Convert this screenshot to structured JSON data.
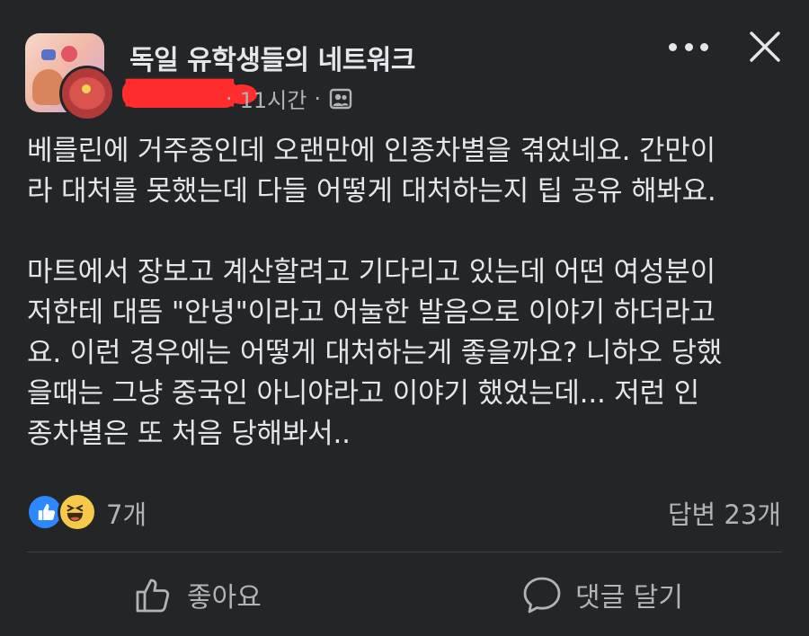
{
  "header": {
    "group_name": "독일 유학생들의 네트워크",
    "time_ago": "11시간",
    "separator": "·",
    "icons": {
      "group_avatar": "group-avatar-image",
      "privacy": "members-icon",
      "more": "more-dots-icon",
      "close": "close-icon"
    }
  },
  "post": {
    "paragraphs": [
      [
        "베를린에 거주중인데 오랜만에 인종차별을 겪었네요. 간만이",
        "라 대처를 못했는데 다들 어떻게 대처하는지 팁 공유 해봐요."
      ],
      [
        "마트에서 장보고 계산할려고 기다리고 있는데 어떤 여성분이",
        "저한테 대뜸 \"안녕\"이라고 어눌한 발음으로 이야기 하더라고",
        "요. 이런 경우에는 어떻게 대처하는게 좋을까요? 니하오 당했",
        "을때는 그냥 중국인 아니야라고 이야기 했었는데... 저런 인",
        "종차별은 또 처음 당해봐서.."
      ]
    ]
  },
  "reactions": {
    "types": [
      "like",
      "haha"
    ],
    "count_label": "7개"
  },
  "comments": {
    "count_label": "답변 23개"
  },
  "actions": {
    "like_label": "좋아요",
    "comment_label": "댓글 달기"
  },
  "colors": {
    "background": "#242526",
    "primary_text": "#e4e6eb",
    "secondary_text": "#b0b3b8",
    "like_blue": "#2d88ff",
    "haha_yellow": "#f7c94a",
    "redaction": "#ff2d2d"
  }
}
